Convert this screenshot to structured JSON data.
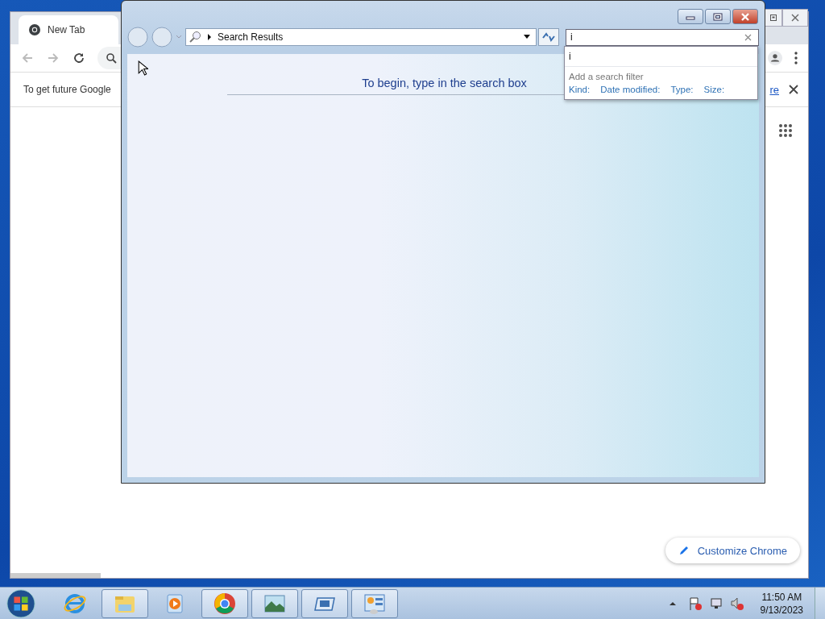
{
  "chrome": {
    "tab": {
      "title": "New Tab"
    },
    "infobar": {
      "text": "To get future Google",
      "link": "re"
    },
    "customize_button": "Customize Chrome"
  },
  "explorer": {
    "address": "Search Results",
    "search": {
      "value": "i"
    },
    "suggestions": [
      "i"
    ],
    "filter_heading": "Add a search filter",
    "filters": [
      "Kind:",
      "Date modified:",
      "Type:",
      "Size:"
    ],
    "message": "To begin, type in the search box"
  },
  "taskbar": {
    "apps": [
      {
        "kind": "browser-e",
        "running": false
      },
      {
        "kind": "folder",
        "running": true
      },
      {
        "kind": "media",
        "running": false
      },
      {
        "kind": "chrome",
        "running": true
      },
      {
        "kind": "photo",
        "running": true
      },
      {
        "kind": "window",
        "running": true
      },
      {
        "kind": "panel",
        "running": true
      }
    ],
    "clock": {
      "time": "11:50 AM",
      "date": "9/13/2023"
    }
  }
}
